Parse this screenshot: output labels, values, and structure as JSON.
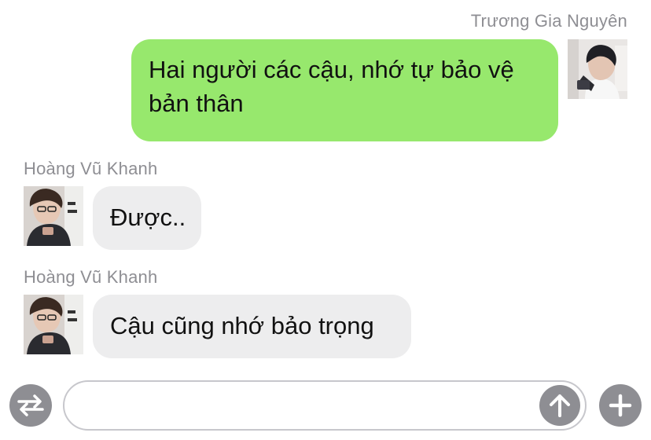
{
  "messages": [
    {
      "sender": "Trương Gia Nguyên",
      "text": "Hai người các cậu, nhớ tự bảo vệ bản thân",
      "direction": "outgoing"
    },
    {
      "sender": "Hoàng Vũ Khanh",
      "text": "Được..",
      "direction": "incoming"
    },
    {
      "sender": "Hoàng Vũ Khanh",
      "text": "Cậu cũng nhớ bảo trọng",
      "direction": "incoming"
    }
  ],
  "composer": {
    "input_value": "",
    "switch_icon": "switch-arrows-icon",
    "send_icon": "arrow-up-icon",
    "add_icon": "plus-icon"
  },
  "colors": {
    "outgoing_bubble": "#97e86d",
    "incoming_bubble": "#ededee",
    "name_gray": "#8e8e93",
    "button_gray": "#8e8e93"
  }
}
